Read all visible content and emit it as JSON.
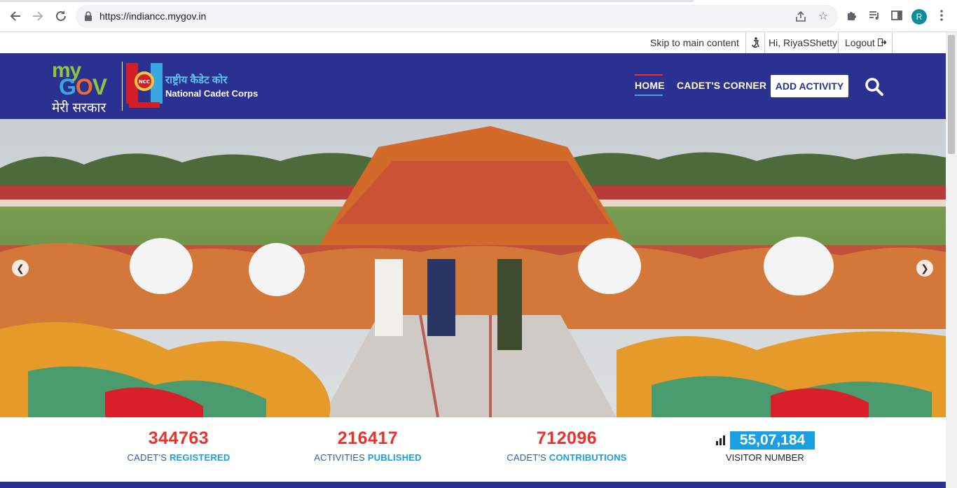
{
  "browser": {
    "url": "https://indiancc.mygov.in",
    "profile_initial": "R"
  },
  "utility_bar": {
    "skip_link": "Skip to main content",
    "greeting": "Hi, RiyaSShetty",
    "logout": "Logout"
  },
  "header": {
    "logo_my": "my",
    "logo_gov": [
      "G",
      "O",
      "V"
    ],
    "logo_hindi": "मेरी सरकार",
    "ncc_hindi": "राष्ट्रीय कैडेट कोर",
    "ncc_english": "National Cadet Corps",
    "ncc_badge_text": "NCC",
    "menu": {
      "home": "HOME",
      "cadets_corner": "CADET'S CORNER",
      "add_activity": "ADD ACTIVITY"
    }
  },
  "stats": {
    "registered": {
      "value": "344763",
      "label_prefix": "CADET'S ",
      "label_bold": "REGISTERED"
    },
    "activities": {
      "value": "216417",
      "label_prefix": "ACTIVITIES ",
      "label_bold": "PUBLISHED"
    },
    "contributions": {
      "value": "712096",
      "label_prefix": "CADET'S ",
      "label_bold": "CONTRIBUTIONS"
    },
    "visitors": {
      "value": "55,07,184",
      "label": "VISITOR NUMBER"
    }
  },
  "colors": {
    "header_bg": "#2b3190",
    "accent_red": "#e8322d",
    "accent_blue": "#1aa0e0"
  },
  "icons": {
    "back": "back-arrow-icon",
    "forward": "forward-arrow-icon",
    "reload": "reload-icon",
    "lock": "lock-icon",
    "share": "share-icon",
    "star": "star-icon",
    "extensions": "puzzle-icon",
    "media": "media-queue-icon",
    "sidepanel": "side-panel-icon",
    "menu": "kebab-menu-icon",
    "accessibility": "accessibility-icon",
    "logout": "logout-icon",
    "search": "search-icon",
    "stats": "bar-chart-icon"
  }
}
